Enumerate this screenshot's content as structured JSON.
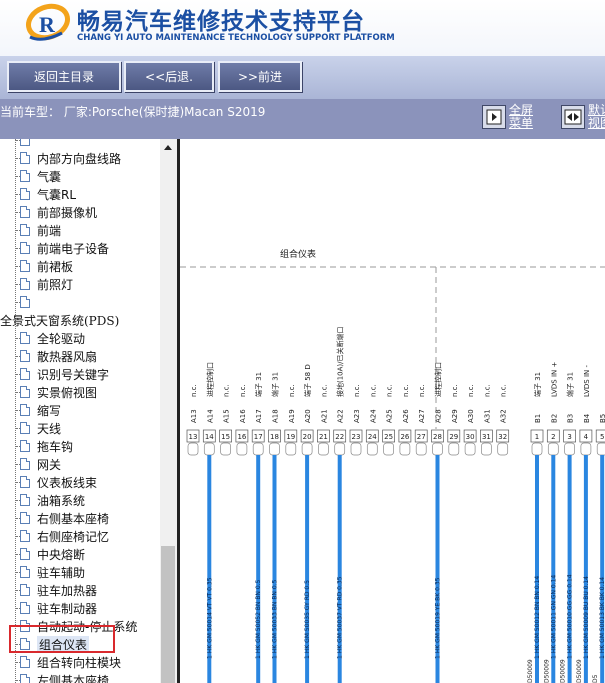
{
  "header": {
    "title_cn": "畅易汽车维修技术支持平台",
    "title_en": "CHANG YI AUTO MAINTENANCE TECHNOLOGY SUPPORT PLATFORM",
    "logo_letter": "R"
  },
  "toolbar": {
    "home": "返回主目录",
    "back": "<<后退.",
    "forward": ">>前进"
  },
  "info": {
    "current_model": "当前车型： 厂家:Porsche(保时捷)Macan S2019",
    "fullscreen_l1": "全屏",
    "fullscreen_l2": "菜单",
    "default_l1": "默认",
    "default_l2": "视图"
  },
  "sidebar": {
    "items": [
      "",
      "内部方向盘线路",
      "气囊",
      "气囊RL",
      "前部摄像机",
      "前端",
      "前端电子设备",
      "前裙板",
      "前照灯",
      "",
      "全景式天窗系统(PDS)",
      "全轮驱动",
      "散热器风扇",
      "识别号关键字",
      "实景俯视图",
      "缩写",
      "天线",
      "拖车钩",
      "网关",
      "仪表板线束",
      "油箱系统",
      "右侧基本座椅",
      "右侧座椅记忆",
      "中央熔断",
      "驻车辅助",
      "驻车加热器",
      "驻车制动器",
      "自动起动-停止系统",
      "组合仪表",
      "组合转向柱模块",
      "左侧基本座椅"
    ],
    "selected": "组合仪表"
  },
  "diagram": {
    "box_label": "组合仪表",
    "pins_left": [
      {
        "id": "A13",
        "num": "13",
        "sig": "n.c.",
        "wire": ""
      },
      {
        "id": "A14",
        "num": "14",
        "sig": "进程控制口",
        "wire": "1 HK GM 50014 VT VT 0.35"
      },
      {
        "id": "A15",
        "num": "15",
        "sig": "n.c.",
        "wire": ""
      },
      {
        "id": "A16",
        "num": "16",
        "sig": "n.c.",
        "wire": ""
      },
      {
        "id": "A17",
        "num": "17",
        "sig": "端子 31",
        "wire": "1 HK GM 50052 BN BN 0.5"
      },
      {
        "id": "A18",
        "num": "18",
        "sig": "端子 31",
        "wire": "1 HK GM 50033 BN BN 0.5"
      },
      {
        "id": "A19",
        "num": "19",
        "sig": "n.c.",
        "wire": ""
      },
      {
        "id": "A20",
        "num": "20",
        "sig": "端子 58 D",
        "wire": "1 HK GM 50035 GY RD 0.5"
      },
      {
        "id": "A21",
        "num": "21",
        "sig": "n.c.",
        "wire": ""
      },
      {
        "id": "A22",
        "num": "22",
        "sig": "接地(10A)/已关断端口",
        "wire": "1 HK GM 50037 VT RD 0.35"
      },
      {
        "id": "A23",
        "num": "23",
        "sig": "n.c.",
        "wire": ""
      },
      {
        "id": "A24",
        "num": "24",
        "sig": "n.c.",
        "wire": ""
      },
      {
        "id": "A25",
        "num": "25",
        "sig": "n.c.",
        "wire": ""
      },
      {
        "id": "A26",
        "num": "26",
        "sig": "n.c.",
        "wire": ""
      },
      {
        "id": "A27",
        "num": "27",
        "sig": "n.c.",
        "wire": ""
      },
      {
        "id": "A28",
        "num": "28",
        "sig": "进程控制口",
        "wire": "1 HK GM 50019 YE BK 0.35"
      },
      {
        "id": "A29",
        "num": "29",
        "sig": "n.c.",
        "wire": ""
      },
      {
        "id": "A30",
        "num": "30",
        "sig": "n.c.",
        "wire": ""
      },
      {
        "id": "A31",
        "num": "31",
        "sig": "n.c.",
        "wire": ""
      },
      {
        "id": "A32",
        "num": "32",
        "sig": "n.c.",
        "wire": ""
      }
    ],
    "pins_right": [
      {
        "id": "B1",
        "num": "1",
        "sig": "端子 31",
        "wire": "1 HK GM 50012 BN BN 0.14",
        "bottom": "D50009"
      },
      {
        "id": "B2",
        "num": "2",
        "sig": "LVDS IN +",
        "wire": "1 HK GM 50011 GN GN 0.14",
        "bottom": "D50009"
      },
      {
        "id": "B3",
        "num": "3",
        "sig": "端子 31",
        "wire": "1 HK GM 50010 GG GG 0.14",
        "bottom": "D50009"
      },
      {
        "id": "B4",
        "num": "4",
        "sig": "LVDS IN -",
        "wire": "1 HK GM 50009 BU BU 0.14",
        "bottom": "D50009"
      },
      {
        "id": "B5",
        "num": "5",
        "sig": "",
        "wire": "1 HK GM 50013 BK BK 0.14",
        "bottom": "D5"
      }
    ]
  }
}
